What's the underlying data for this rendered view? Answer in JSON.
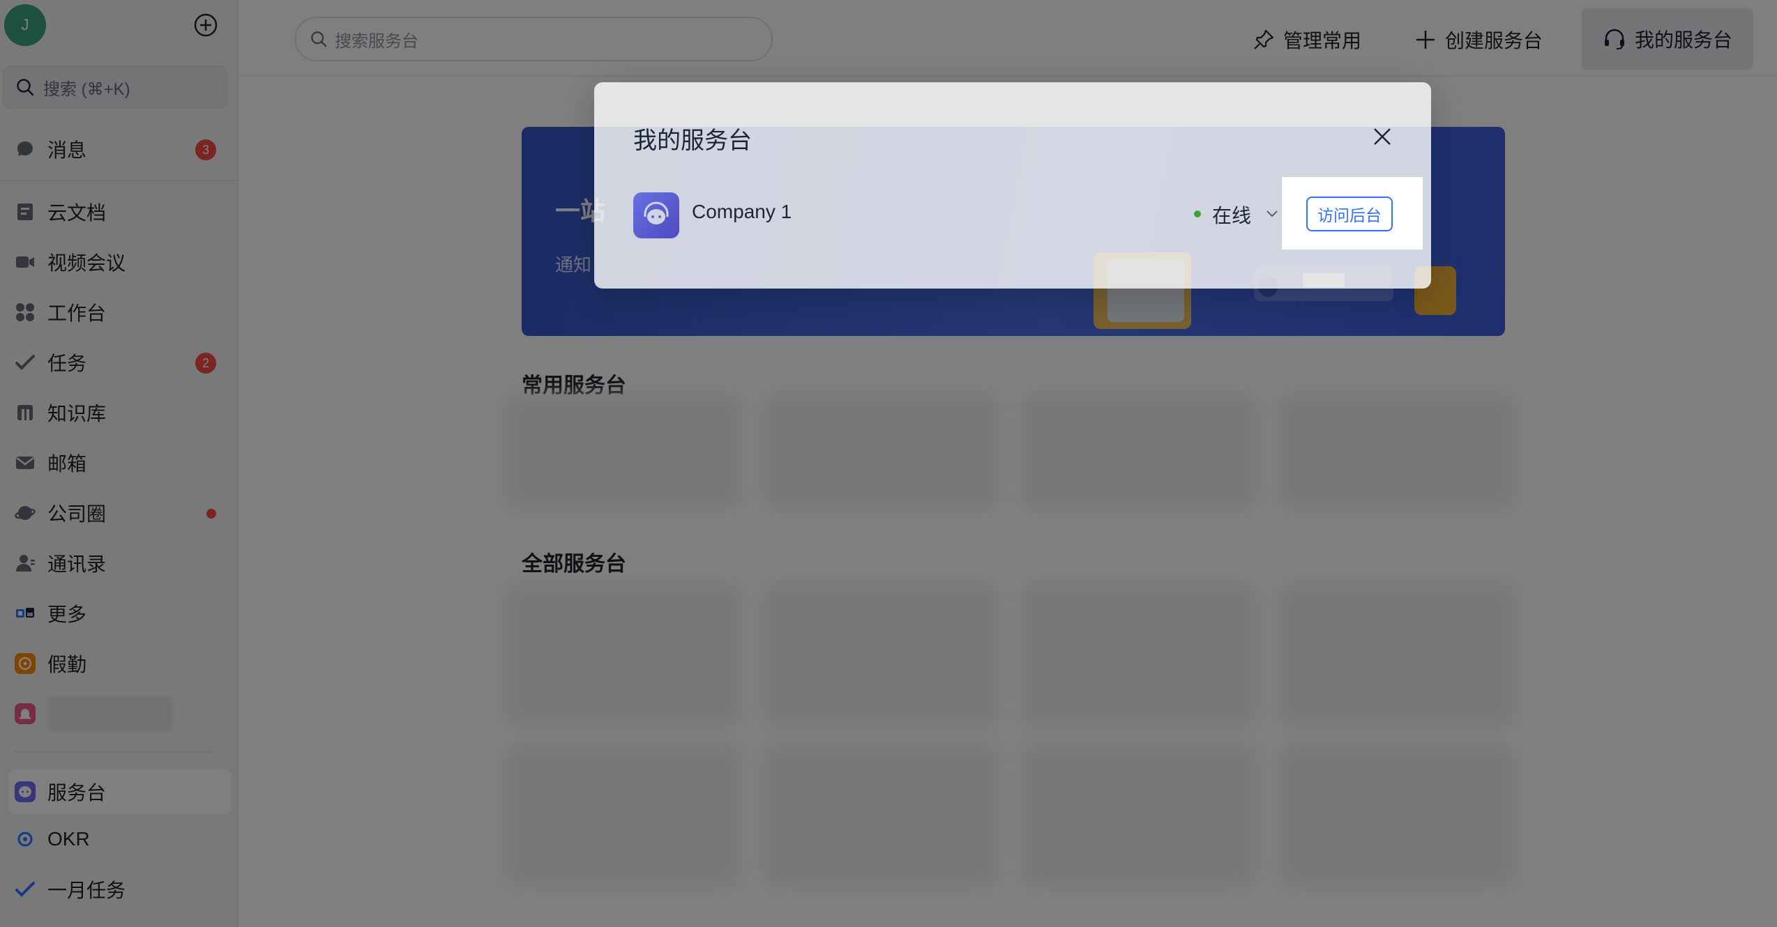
{
  "sidebar": {
    "avatar_letter": "J",
    "search_placeholder": "搜索 (⌘+K)",
    "items": [
      {
        "label": "消息",
        "badge": "3"
      },
      {
        "label": "云文档"
      },
      {
        "label": "视频会议"
      },
      {
        "label": "工作台"
      },
      {
        "label": "任务",
        "badge": "2"
      },
      {
        "label": "知识库"
      },
      {
        "label": "邮箱"
      },
      {
        "label": "公司圈"
      },
      {
        "label": "通讯录"
      },
      {
        "label": "更多"
      },
      {
        "label": "假勤"
      },
      {
        "label": "服务台"
      },
      {
        "label": "OKR"
      },
      {
        "label": "一月任务"
      }
    ]
  },
  "topbar": {
    "search_placeholder": "搜索服务台",
    "manage_label": "管理常用",
    "create_label": "创建服务台",
    "my_label": "我的服务台"
  },
  "banner": {
    "title_fragment": "一站",
    "subtitle_fragment": "通知"
  },
  "sections": {
    "common": "常用服务台",
    "all": "全部服务台"
  },
  "modal": {
    "title": "我的服务台",
    "desk_name": "Company 1",
    "status": "在线",
    "visit_button": "访问后台"
  },
  "colors": {
    "accent": "#3370ff",
    "badge": "#f54a45",
    "online": "#34c724"
  }
}
